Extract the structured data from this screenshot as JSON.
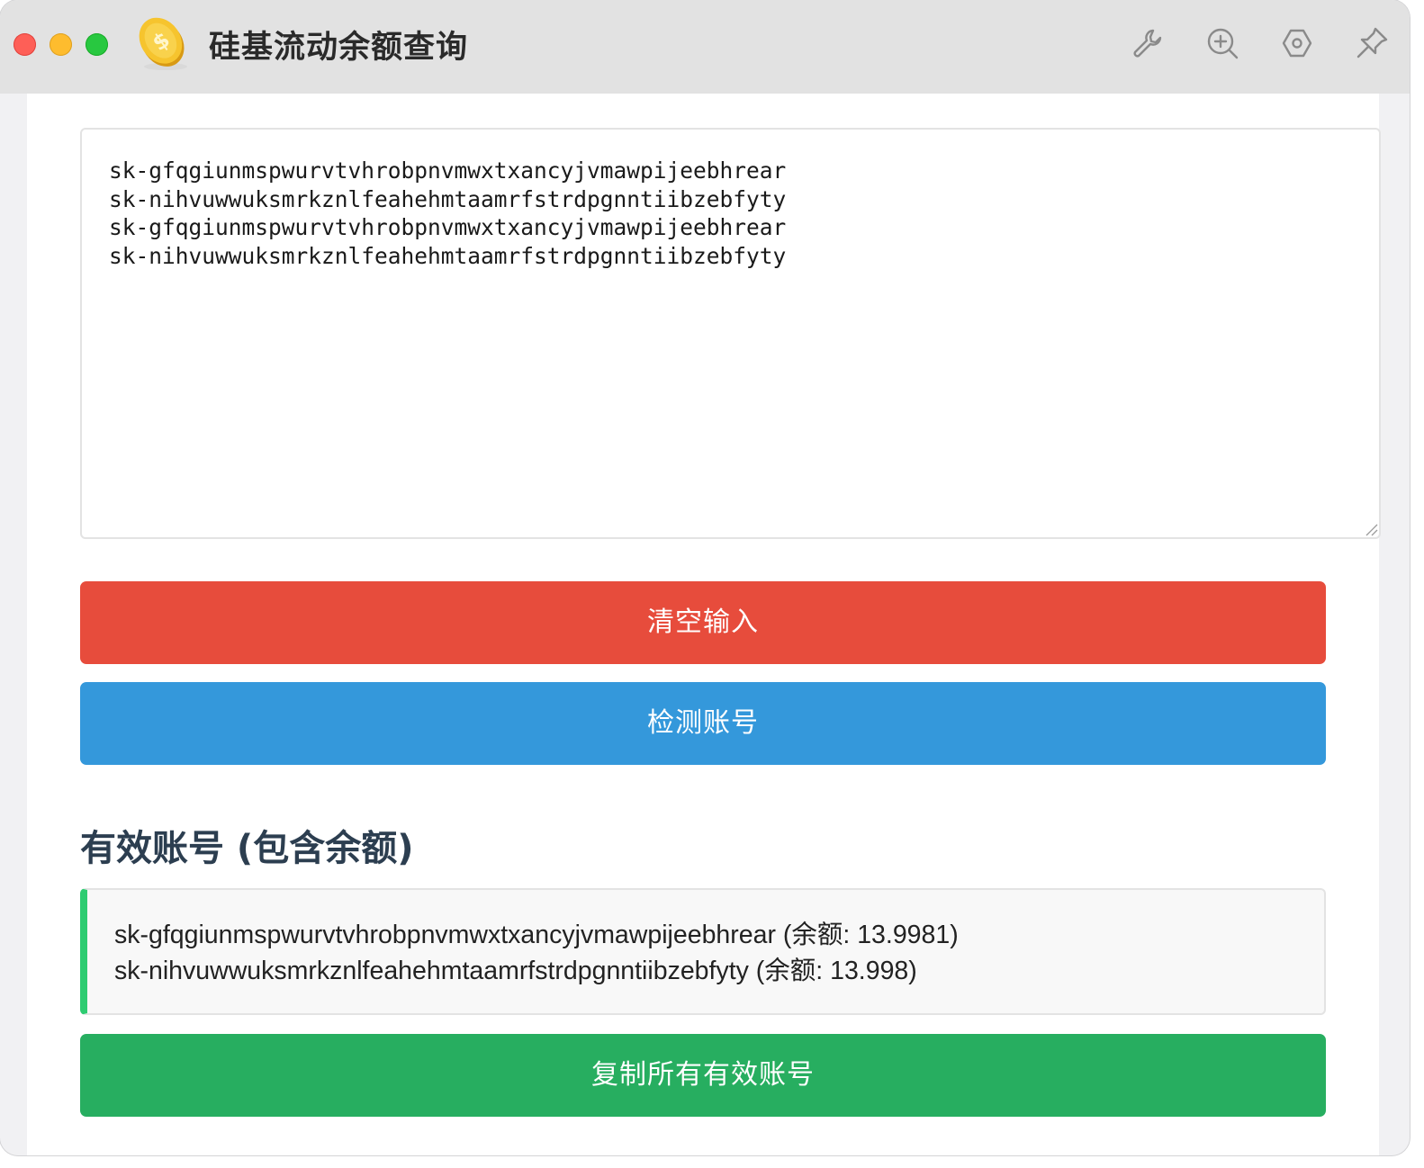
{
  "window": {
    "title": "硅基流动余额查询",
    "toolbar_icons": [
      "wrench-icon",
      "zoom-in-icon",
      "settings-icon",
      "pin-icon"
    ]
  },
  "input": {
    "value": "sk-gfqgiunmspwurvtvhrobpnvmwxtxancyjvmawpijeebhrear\nsk-nihvuwwuksmrkznlfeahehmtaamrfstrdpgnntiibzebfyty\nsk-gfqgiunmspwurvtvhrobpnvmwxtxancyjvmawpijeebhrear\nsk-nihvuwwuksmrkznlfeahehmtaamrfstrdpgnntiibzebfyty"
  },
  "buttons": {
    "clear_label": "清空输入",
    "check_label": "检测账号",
    "copy_label": "复制所有有效账号"
  },
  "results": {
    "title": "有效账号 (包含余额)",
    "valid_accounts": [
      "sk-gfqgiunmspwurvtvhrobpnvmwxtxancyjvmawpijeebhrear (余额: 13.9981)",
      "sk-nihvuwwuksmrkznlfeahehmtaamrfstrdpgnntiibzebfyty (余额: 13.998)"
    ]
  },
  "colors": {
    "clear": "#e74c3c",
    "check": "#3498db",
    "copy": "#27ae60",
    "valid_accent": "#2ecc71",
    "heading": "#2c3e50"
  }
}
